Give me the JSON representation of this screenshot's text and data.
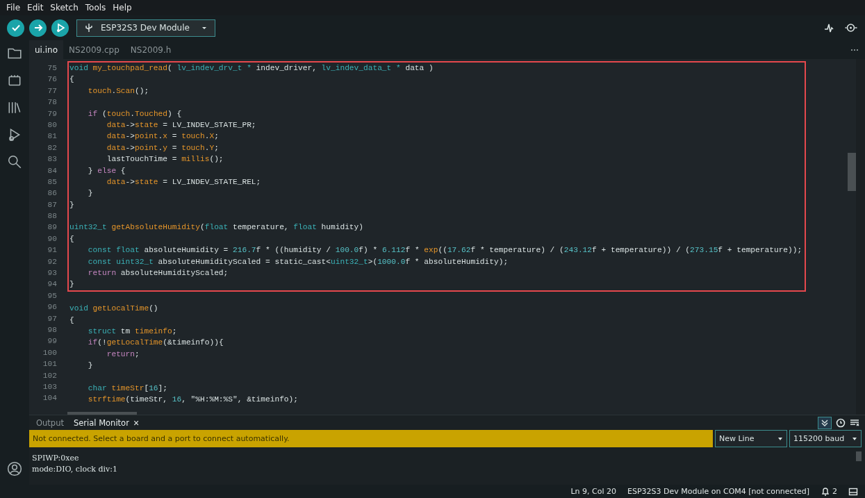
{
  "menu": [
    "File",
    "Edit",
    "Sketch",
    "Tools",
    "Help"
  ],
  "toolbar": {
    "board": "ESP32S3 Dev Module"
  },
  "file_tabs": [
    {
      "label": "ui.ino",
      "selected": true
    },
    {
      "label": "NS2009.cpp",
      "selected": false
    },
    {
      "label": "NS2009.h",
      "selected": false
    }
  ],
  "code_blocks": [
    {
      "highlighted": true,
      "lines": [
        {
          "number": "75",
          "tokens": [
            {
              "kind": "type",
              "text": "void "
            },
            {
              "kind": "func",
              "text": "my_touchpad_read"
            },
            {
              "kind": "plain",
              "text": "( "
            },
            {
              "kind": "type",
              "text": "lv_indev_drv_t * "
            },
            {
              "kind": "plain",
              "text": "indev_driver, "
            },
            {
              "kind": "type",
              "text": "lv_indev_data_t * "
            },
            {
              "kind": "plain",
              "text": "data )"
            }
          ]
        },
        {
          "number": "76",
          "tokens": [
            {
              "kind": "plain",
              "text": "{"
            }
          ]
        },
        {
          "number": "77",
          "tokens": [
            {
              "kind": "func",
              "text": "    touch"
            },
            {
              "kind": "plain",
              "text": "."
            },
            {
              "kind": "func",
              "text": "Scan"
            },
            {
              "kind": "plain",
              "text": "();"
            }
          ]
        },
        {
          "number": "78"
        },
        {
          "number": "79",
          "tokens": [
            {
              "kind": "keyword",
              "text": "    if"
            },
            {
              "kind": "plain",
              "text": " ("
            },
            {
              "kind": "func",
              "text": "touch"
            },
            {
              "kind": "plain",
              "text": "."
            },
            {
              "kind": "func",
              "text": "Touched"
            },
            {
              "kind": "plain",
              "text": ") {"
            }
          ]
        },
        {
          "number": "80",
          "tokens": [
            {
              "kind": "func",
              "text": "        data"
            },
            {
              "kind": "plain",
              "text": "->"
            },
            {
              "kind": "func",
              "text": "state"
            },
            {
              "kind": "plain",
              "text": " = LV_INDEV_STATE_PR;"
            }
          ]
        },
        {
          "number": "81",
          "tokens": [
            {
              "kind": "func",
              "text": "        data"
            },
            {
              "kind": "plain",
              "text": "->"
            },
            {
              "kind": "func",
              "text": "point"
            },
            {
              "kind": "plain",
              "text": "."
            },
            {
              "kind": "func",
              "text": "x"
            },
            {
              "kind": "plain",
              "text": " = "
            },
            {
              "kind": "func",
              "text": "touch"
            },
            {
              "kind": "plain",
              "text": "."
            },
            {
              "kind": "func",
              "text": "X"
            },
            {
              "kind": "plain",
              "text": ";"
            }
          ]
        },
        {
          "number": "82",
          "tokens": [
            {
              "kind": "func",
              "text": "        data"
            },
            {
              "kind": "plain",
              "text": "->"
            },
            {
              "kind": "func",
              "text": "point"
            },
            {
              "kind": "plain",
              "text": "."
            },
            {
              "kind": "func",
              "text": "y"
            },
            {
              "kind": "plain",
              "text": " = "
            },
            {
              "kind": "func",
              "text": "touch"
            },
            {
              "kind": "plain",
              "text": "."
            },
            {
              "kind": "func",
              "text": "Y"
            },
            {
              "kind": "plain",
              "text": ";"
            }
          ]
        },
        {
          "number": "83",
          "tokens": [
            {
              "kind": "plain",
              "text": "        lastTouchTime = "
            },
            {
              "kind": "func",
              "text": "millis"
            },
            {
              "kind": "plain",
              "text": "();"
            }
          ]
        },
        {
          "number": "84",
          "tokens": [
            {
              "kind": "plain",
              "text": "    } "
            },
            {
              "kind": "keyword",
              "text": "else"
            },
            {
              "kind": "plain",
              "text": " {"
            }
          ]
        },
        {
          "number": "85",
          "tokens": [
            {
              "kind": "func",
              "text": "        data"
            },
            {
              "kind": "plain",
              "text": "->"
            },
            {
              "kind": "func",
              "text": "state"
            },
            {
              "kind": "plain",
              "text": " = LV_INDEV_STATE_REL;"
            }
          ]
        },
        {
          "number": "86",
          "tokens": [
            {
              "kind": "plain",
              "text": "    }"
            }
          ]
        },
        {
          "number": "87",
          "tokens": [
            {
              "kind": "plain",
              "text": "}"
            }
          ]
        },
        {
          "number": "88"
        },
        {
          "number": "89",
          "tokens": [
            {
              "kind": "type",
              "text": "uint32_t "
            },
            {
              "kind": "func",
              "text": "getAbsoluteHumidity"
            },
            {
              "kind": "plain",
              "text": "("
            },
            {
              "kind": "type",
              "text": "float"
            },
            {
              "kind": "plain",
              "text": " temperature, "
            },
            {
              "kind": "type",
              "text": "float"
            },
            {
              "kind": "plain",
              "text": " humidity)"
            }
          ]
        },
        {
          "number": "90",
          "tokens": [
            {
              "kind": "plain",
              "text": "{"
            }
          ]
        },
        {
          "number": "91",
          "tokens": [
            {
              "kind": "type",
              "text": "    const float"
            },
            {
              "kind": "plain",
              "text": " absoluteHumidity = "
            },
            {
              "kind": "number",
              "text": "216.7"
            },
            {
              "kind": "plain",
              "text": "f * ((humidity / "
            },
            {
              "kind": "number",
              "text": "100.0"
            },
            {
              "kind": "plain",
              "text": "f) * "
            },
            {
              "kind": "number",
              "text": "6.112"
            },
            {
              "kind": "plain",
              "text": "f * "
            },
            {
              "kind": "func",
              "text": "exp"
            },
            {
              "kind": "plain",
              "text": "(("
            },
            {
              "kind": "number",
              "text": "17.62"
            },
            {
              "kind": "plain",
              "text": "f * temperature) / ("
            },
            {
              "kind": "number",
              "text": "243.12"
            },
            {
              "kind": "plain",
              "text": "f + temperature)) / ("
            },
            {
              "kind": "number",
              "text": "273.15"
            },
            {
              "kind": "plain",
              "text": "f + temperature));"
            }
          ]
        },
        {
          "number": "92",
          "tokens": [
            {
              "kind": "type",
              "text": "    const uint32_t"
            },
            {
              "kind": "plain",
              "text": " absoluteHumidityScaled = static_cast<"
            },
            {
              "kind": "type",
              "text": "uint32_t"
            },
            {
              "kind": "plain",
              "text": ">("
            },
            {
              "kind": "number",
              "text": "1000.0"
            },
            {
              "kind": "plain",
              "text": "f * absoluteHumidity);"
            }
          ]
        },
        {
          "number": "93",
          "tokens": [
            {
              "kind": "keyword",
              "text": "    return"
            },
            {
              "kind": "plain",
              "text": " absoluteHumidityScaled;"
            }
          ]
        },
        {
          "number": "94",
          "tokens": [
            {
              "kind": "plain",
              "text": "}"
            }
          ]
        }
      ]
    },
    {
      "highlighted": false,
      "lines": [
        {
          "number": "95"
        },
        {
          "number": "96",
          "tokens": [
            {
              "kind": "type",
              "text": "void "
            },
            {
              "kind": "func",
              "text": "getLocalTime"
            },
            {
              "kind": "plain",
              "text": "()"
            }
          ]
        },
        {
          "number": "97",
          "tokens": [
            {
              "kind": "plain",
              "text": "{"
            }
          ]
        },
        {
          "number": "98",
          "tokens": [
            {
              "kind": "type",
              "text": "    struct"
            },
            {
              "kind": "plain",
              "text": " tm "
            },
            {
              "kind": "func",
              "text": "timeinfo"
            },
            {
              "kind": "plain",
              "text": ";"
            }
          ]
        },
        {
          "number": "99",
          "tokens": [
            {
              "kind": "keyword",
              "text": "    if"
            },
            {
              "kind": "plain",
              "text": "(!"
            },
            {
              "kind": "func",
              "text": "getLocalTime"
            },
            {
              "kind": "plain",
              "text": "(&timeinfo)){"
            }
          ]
        },
        {
          "number": "100",
          "tokens": [
            {
              "kind": "keyword",
              "text": "        return"
            },
            {
              "kind": "plain",
              "text": ";"
            }
          ]
        },
        {
          "number": "101",
          "tokens": [
            {
              "kind": "plain",
              "text": "    }"
            }
          ]
        },
        {
          "number": "102"
        },
        {
          "number": "103",
          "tokens": [
            {
              "kind": "type",
              "text": "    char "
            },
            {
              "kind": "func",
              "text": "timeStr"
            },
            {
              "kind": "plain",
              "text": "["
            },
            {
              "kind": "number",
              "text": "16"
            },
            {
              "kind": "plain",
              "text": "];"
            }
          ]
        },
        {
          "number": "104",
          "tokens": [
            {
              "kind": "func",
              "text": "    strftime"
            },
            {
              "kind": "plain",
              "text": "(timeStr, "
            },
            {
              "kind": "number",
              "text": "16"
            },
            {
              "kind": "plain",
              "text": ", \"%H:%M:%S\", &timeinfo);"
            }
          ]
        }
      ]
    }
  ],
  "bottom_panel": {
    "tabs": [
      {
        "label": "Output",
        "selected": false
      },
      {
        "label": "Serial Monitor",
        "selected": true,
        "close": "×"
      }
    ],
    "autoscroll_on": true,
    "message": "Not connected. Select a board and a port to connect automatically.",
    "line_ending": "New Line",
    "baud": "115200 baud",
    "output": [
      "SPIWP:0xee",
      "mode:DIO, clock div:1"
    ]
  },
  "status_bar": {
    "position": "Ln 9, Col 20",
    "board": "ESP32S3 Dev Module on COM4 [not connected]",
    "notifications": "2"
  }
}
